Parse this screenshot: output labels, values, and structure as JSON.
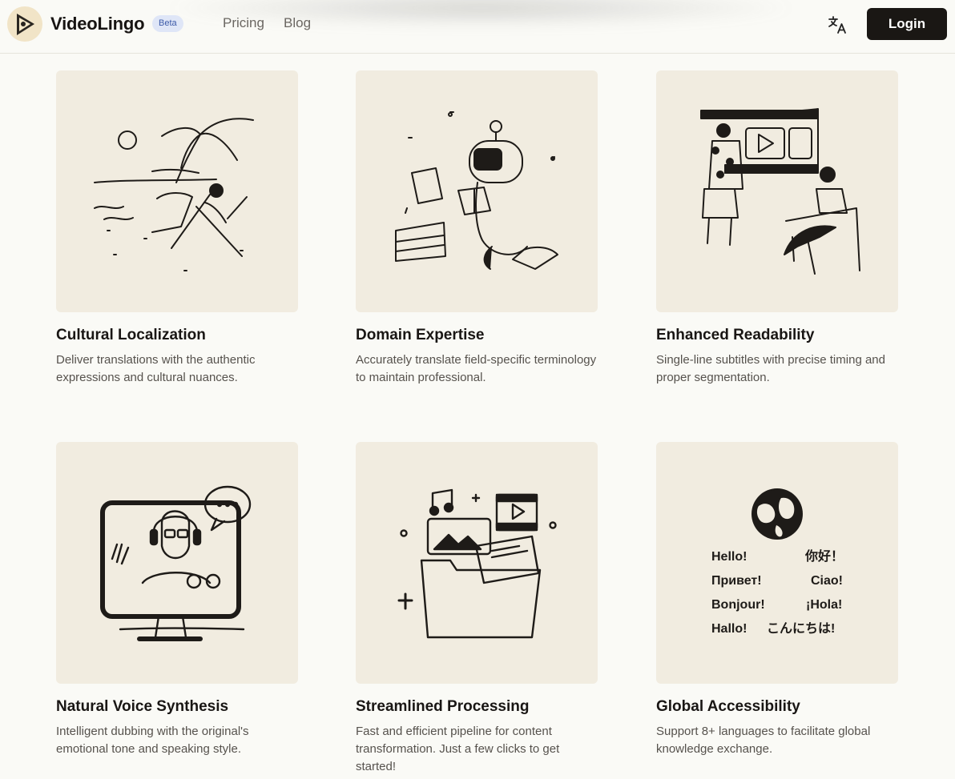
{
  "header": {
    "brand": "VideoLingo",
    "badge": "Beta",
    "nav": [
      "Pricing",
      "Blog"
    ],
    "login": "Login"
  },
  "features": [
    {
      "title": "Cultural Localization",
      "desc": "Deliver translations with the authentic expressions and cultural nuances.",
      "illustration": "beach-relax"
    },
    {
      "title": "Domain Expertise",
      "desc": "Accurately translate field-specific terminology to maintain professional.",
      "illustration": "robot-reading"
    },
    {
      "title": "Enhanced Readability",
      "desc": "Single-line subtitles with precise timing and proper segmentation.",
      "illustration": "film-strip-people"
    },
    {
      "title": "Natural Voice Synthesis",
      "desc": "Intelligent dubbing with the original's emotional tone and speaking style.",
      "illustration": "video-call-monitor"
    },
    {
      "title": "Streamlined Processing",
      "desc": "Fast and efficient pipeline for content transformation. Just a few clicks to get started!",
      "illustration": "media-folder"
    },
    {
      "title": "Global Accessibility",
      "desc": "Support 8+ languages to facilitate global knowledge exchange.",
      "illustration": "globe-greetings",
      "greetings": [
        "Hello!",
        "你好！",
        "Привет!",
        "Ciao!",
        "Bonjour!",
        "¡Hola!",
        "Hallo!",
        "こんにちは!"
      ]
    }
  ],
  "colors": {
    "card_bg": "#f1ece0",
    "page_bg": "#fafaf6",
    "button_bg": "#1a1714",
    "beta_bg": "#dfe6f7"
  }
}
